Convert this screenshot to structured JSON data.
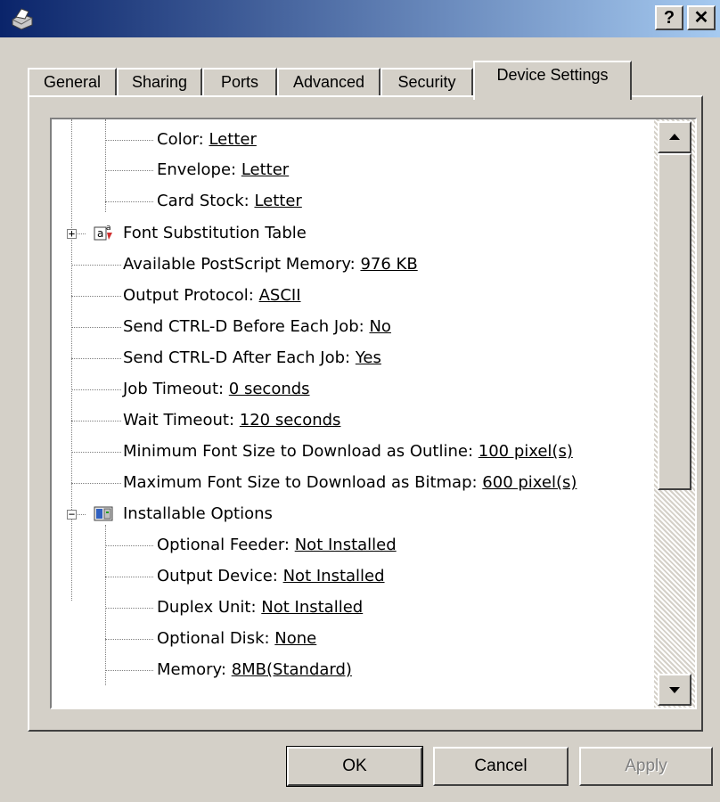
{
  "window": {
    "icon": "printer-icon",
    "help_label": "?",
    "close_label": "✕"
  },
  "tabs": [
    {
      "label": "General"
    },
    {
      "label": "Sharing"
    },
    {
      "label": "Ports"
    },
    {
      "label": "Advanced"
    },
    {
      "label": "Security"
    },
    {
      "label": "Device Settings",
      "active": true
    }
  ],
  "tree": {
    "items": [
      {
        "label": "Color: ",
        "value": "Letter",
        "level": 2
      },
      {
        "label": "Envelope: ",
        "value": "Letter",
        "level": 2
      },
      {
        "label": "Card Stock: ",
        "value": "Letter",
        "level": 2
      },
      {
        "label": "Font Substitution Table",
        "value": "",
        "level": 1,
        "expander": "+",
        "icon": "font-substitution-icon"
      },
      {
        "label": "Available PostScript Memory: ",
        "value": "976 KB",
        "level": 1
      },
      {
        "label": "Output Protocol: ",
        "value": "ASCII",
        "level": 1
      },
      {
        "label": "Send CTRL-D Before Each Job: ",
        "value": "No",
        "level": 1
      },
      {
        "label": "Send CTRL-D After Each Job: ",
        "value": "Yes",
        "level": 1
      },
      {
        "label": "Job Timeout: ",
        "value": "0 seconds",
        "level": 1
      },
      {
        "label": "Wait Timeout: ",
        "value": "120 seconds",
        "level": 1
      },
      {
        "label": "Minimum Font Size to Download as Outline: ",
        "value": "100 pixel(s)",
        "level": 1
      },
      {
        "label": "Maximum Font Size to Download as Bitmap: ",
        "value": "600 pixel(s)",
        "level": 1
      },
      {
        "label": "Installable Options",
        "value": "",
        "level": 1,
        "expander": "−",
        "icon": "installable-options-icon"
      },
      {
        "label": "Optional Feeder: ",
        "value": "Not Installed",
        "level": 2
      },
      {
        "label": "Output Device: ",
        "value": "Not Installed",
        "level": 2
      },
      {
        "label": "Duplex Unit: ",
        "value": "Not Installed",
        "level": 2
      },
      {
        "label": "Optional Disk: ",
        "value": "None",
        "level": 2
      },
      {
        "label": "Memory: ",
        "value": "8MB(Standard)",
        "level": 2
      }
    ]
  },
  "scrollbar": {
    "up_icon": "scroll-up-arrow-icon",
    "down_icon": "scroll-down-arrow-icon"
  },
  "buttons": {
    "ok": "OK",
    "cancel": "Cancel",
    "apply": "Apply"
  }
}
